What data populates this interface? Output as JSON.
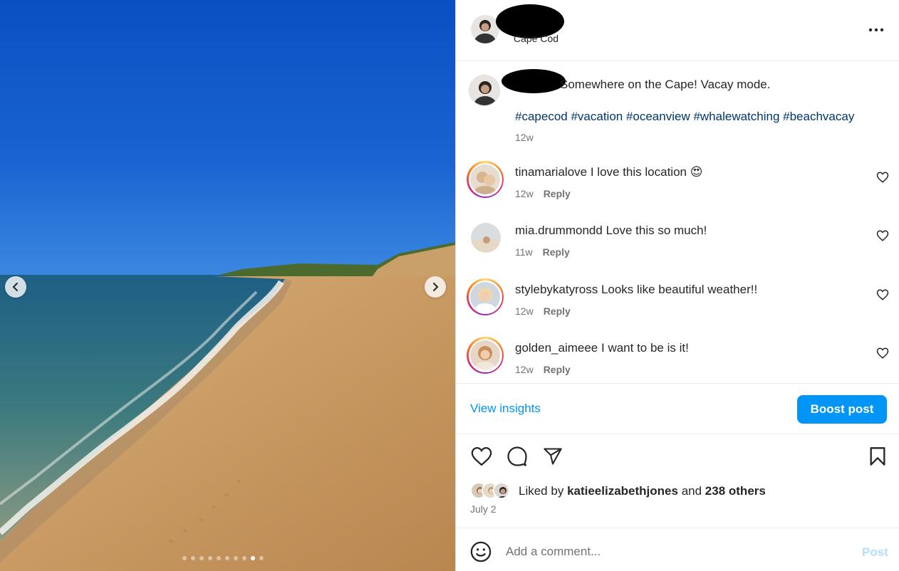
{
  "colors": {
    "accent": "#0095f6",
    "hashtag": "#00376b",
    "muted": "#737373",
    "text": "#262626",
    "post_disabled": "#b2dffc"
  },
  "carousel": {
    "slide_count": 10,
    "active_slide": 9
  },
  "header": {
    "location": "Cape Cod",
    "more_icon": "more-horizontal-icon"
  },
  "caption": {
    "text": "Somewhere on the Cape! Vacay mode.",
    "hashtags": "#capecod #vacation #oceanview #whalewatching #beachvacay",
    "time": "12w"
  },
  "comments": [
    {
      "username": "tinamarialove",
      "text": "I love this location 😍",
      "time": "12w",
      "reply": "Reply"
    },
    {
      "username": "mia.drummondd",
      "text": "Love this so much!",
      "time": "11w",
      "reply": "Reply"
    },
    {
      "username": "stylebykatyross",
      "text": "Looks like beautiful weather!!",
      "time": "12w",
      "reply": "Reply"
    },
    {
      "username": "golden_aimeee",
      "text": "I want to be is it!",
      "time": "12w",
      "reply": "Reply"
    }
  ],
  "insights": {
    "view_label": "View insights",
    "boost_label": "Boost post"
  },
  "likes": {
    "prefix": "Liked by",
    "user": "katieelizabethjones",
    "and": "and",
    "others": "238 others"
  },
  "post_date": "July 2",
  "comment_box": {
    "placeholder": "Add a comment...",
    "post_label": "Post"
  }
}
